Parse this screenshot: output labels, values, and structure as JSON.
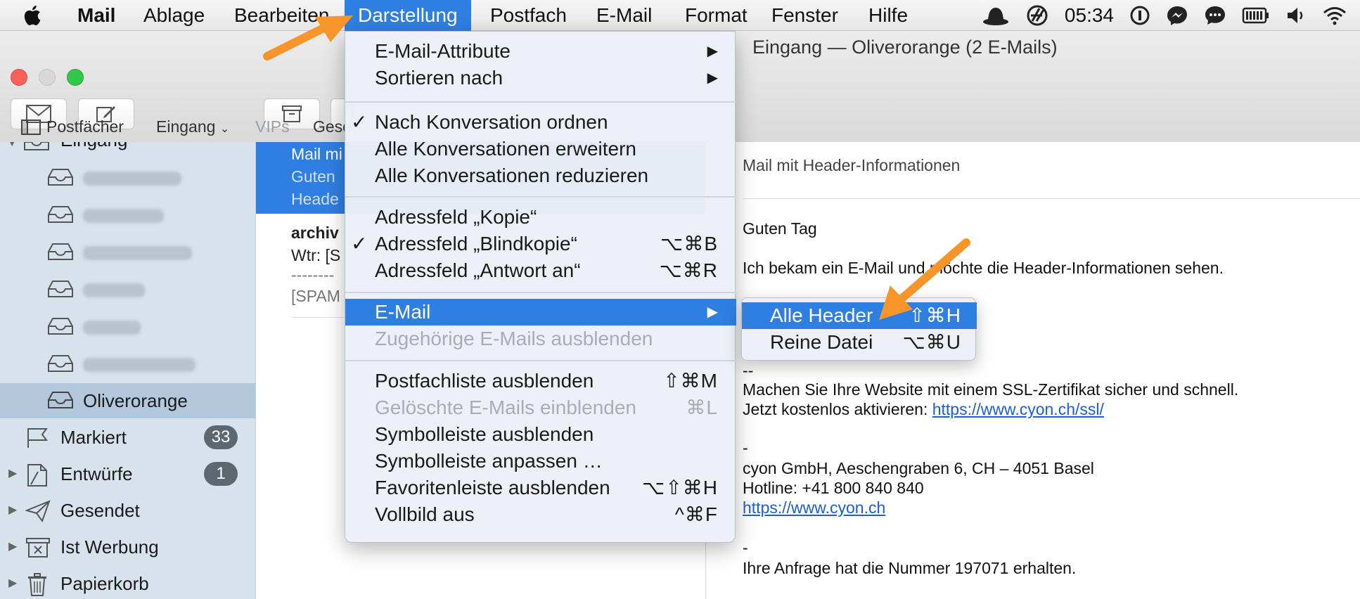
{
  "menubar": {
    "apple_icon": "apple-logo",
    "items": [
      "Mail",
      "Ablage",
      "Bearbeiten",
      "Darstellung",
      "Postfach",
      "E-Mail",
      "Format",
      "Fenster",
      "Hilfe"
    ],
    "active_index": 3,
    "status_icons": [
      "hat-icon",
      "cyon-icon",
      "info-icon",
      "messenger-icon",
      "chat-icon",
      "battery-icon",
      "volume-icon",
      "wifi-icon"
    ],
    "clock": "05:34"
  },
  "window": {
    "title": "Eingang — Oliverorange (2 E-Mails)"
  },
  "favorites_bar": {
    "mailboxes": "Postfächer",
    "inbox": "Eingang",
    "vips": "VIPs",
    "sent_partial": "Gese"
  },
  "sidebar": {
    "inbox_partial": "Eingang",
    "selected_account": "Oliverorange",
    "folders": [
      {
        "label": "Markiert",
        "icon": "flag-icon",
        "badge": "33"
      },
      {
        "label": "Entwürfe",
        "icon": "draft-icon",
        "badge": "1"
      },
      {
        "label": "Gesendet",
        "icon": "paperplane-icon",
        "badge": ""
      },
      {
        "label": "Ist Werbung",
        "icon": "junk-icon",
        "badge": ""
      },
      {
        "label": "Papierkorb",
        "icon": "trash-icon",
        "badge": ""
      }
    ]
  },
  "message_list": {
    "selected": {
      "line1": "Mail mi",
      "line2": "Guten",
      "line3": "Heade"
    },
    "second": {
      "line1": "archiv",
      "line2": "Wtr: [S",
      "line3": "--------",
      "line4": "[SPAM"
    }
  },
  "reader": {
    "subject": "Mail mit Header-Informationen",
    "greeting": "Guten Tag",
    "body1": "Ich bekam ein E-Mail und möchte die Header-Informationen sehen.",
    "sep1": "--",
    "ssl_text": "Machen Sie Ihre Website mit einem SSL-Zertifikat sicher und schnell.",
    "ssl_prefix": "Jetzt kostenlos aktivieren: ",
    "ssl_link": "https://www.cyon.ch/ssl/",
    "sep2": "-",
    "company": "cyon GmbH, Aeschengraben 6, CH – 4051 Basel",
    "hotline": "Hotline: +41 800 840 840",
    "company_link": "https://www.cyon.ch",
    "sep3": "-",
    "request": "Ihre Anfrage hat die Nummer 197071 erhalten."
  },
  "dropdown": {
    "items": [
      {
        "label": "E-Mail-Attribute",
        "submenu": true
      },
      {
        "label": "Sortieren nach",
        "submenu": true
      },
      {
        "label": "Nach Konversation ordnen",
        "check": true
      },
      {
        "label": "Alle Konversationen erweitern"
      },
      {
        "label": "Alle Konversationen reduzieren"
      },
      {
        "label": "Adressfeld „Kopie“"
      },
      {
        "label": "Adressfeld „Blindkopie“",
        "check": true,
        "shortcut": "⌥⌘B"
      },
      {
        "label": "Adressfeld „Antwort an“",
        "shortcut": "⌥⌘R"
      },
      {
        "label": "E-Mail",
        "submenu": true,
        "highlighted": true
      },
      {
        "label": "Zugehörige E-Mails ausblenden",
        "disabled": true
      },
      {
        "label": "Postfachliste ausblenden",
        "shortcut": "⇧⌘M"
      },
      {
        "label": "Gelöschte E-Mails einblenden",
        "shortcut": "⌘L",
        "disabled": true
      },
      {
        "label": "Symbolleiste ausblenden"
      },
      {
        "label": "Symbolleiste anpassen …"
      },
      {
        "label": "Favoritenleiste ausblenden",
        "shortcut": "⌥⇧⌘H"
      },
      {
        "label": "Vollbild aus",
        "shortcut": "^⌘F"
      }
    ],
    "checkmark": "✓",
    "arrow": "▶"
  },
  "submenu": {
    "items": [
      {
        "label": "Alle Header",
        "shortcut": "⇧⌘H",
        "highlighted": true
      },
      {
        "label": "Reine Datei",
        "shortcut": "⌥⌘U"
      }
    ]
  },
  "colors": {
    "accent": "#2f7fe3",
    "annotation": "#f7952a",
    "sidebar": "#d8e2ed"
  }
}
